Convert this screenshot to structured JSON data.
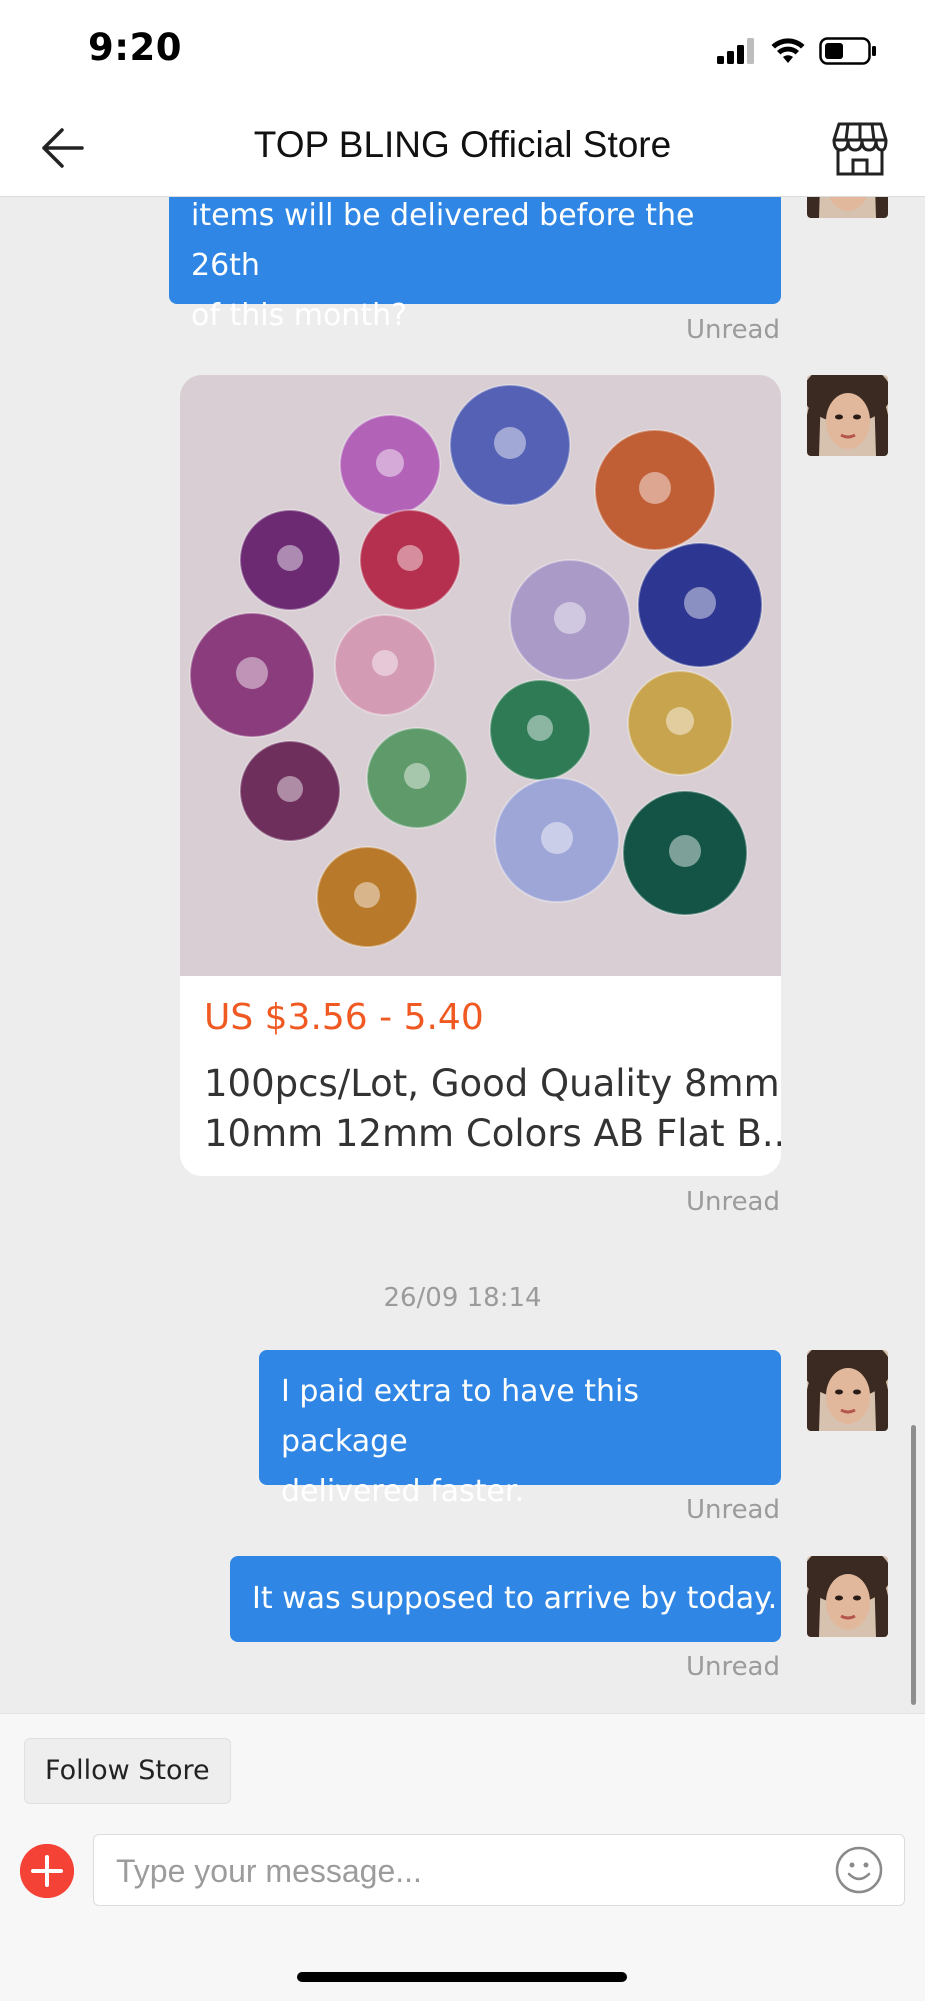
{
  "status_bar": {
    "time": "9:20",
    "icons": [
      "cellular-signal-icon",
      "wifi-icon",
      "battery-icon"
    ]
  },
  "header": {
    "title": "TOP BLING Official Store",
    "back_icon": "arrow-left-icon",
    "store_icon": "storefront-icon"
  },
  "messages": [
    {
      "type": "text",
      "text_lines": [
        "items will be delivered before the 26th",
        "of this month?"
      ],
      "status": "Unread"
    },
    {
      "type": "product",
      "price": "US $3.56 - 5.40",
      "title_lines": [
        "100pcs/Lot, Good Quality 8mm",
        "10mm 12mm Colors AB Flat B..."
      ],
      "status": "Unread"
    },
    {
      "type": "date",
      "text": "26/09 18:14"
    },
    {
      "type": "text",
      "text_lines": [
        "I paid extra to have this package",
        "delivered faster."
      ],
      "status": "Unread"
    },
    {
      "type": "text",
      "text_lines": [
        "It was supposed to arrive by today."
      ],
      "status": "Unread"
    }
  ],
  "footer": {
    "follow_label": "Follow Store",
    "input_placeholder": "Type your message...",
    "add_icon": "plus-circle-icon",
    "emoji_icon": "smiley-icon"
  },
  "colors": {
    "bubble": "#2f86e4",
    "price": "#f05a22",
    "chat_bg": "#eeedee",
    "add_button": "#f44336"
  }
}
